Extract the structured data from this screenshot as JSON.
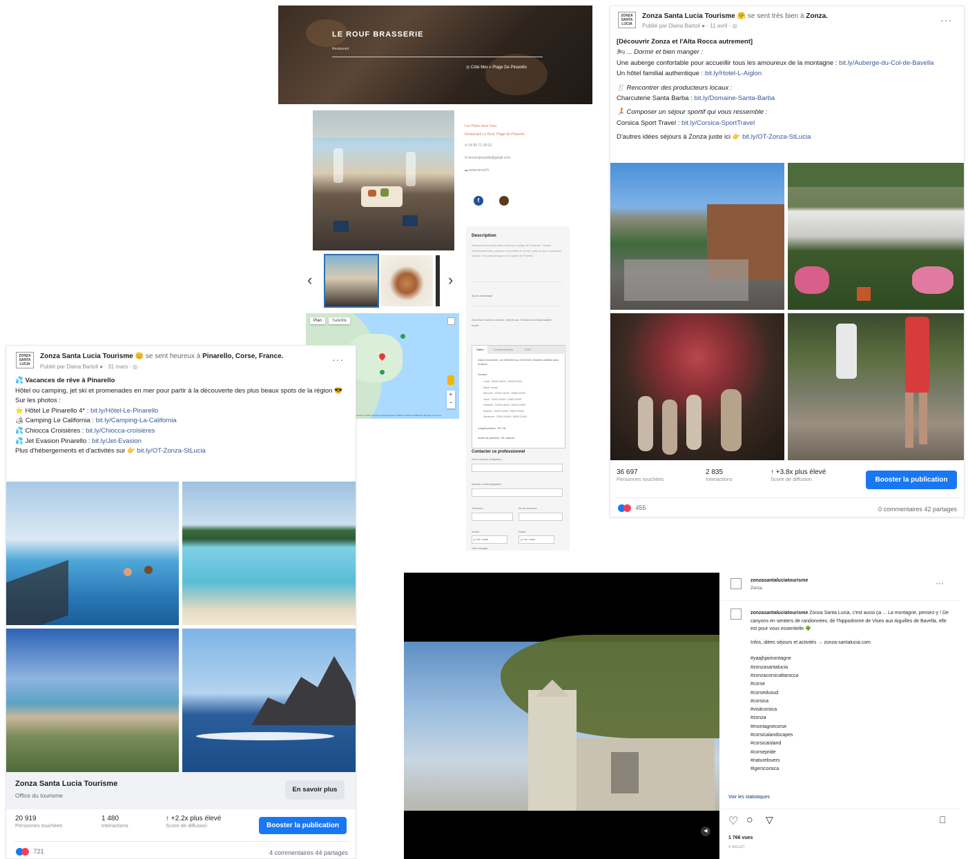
{
  "restaurant": {
    "title": "LE ROUF BRASSERIE",
    "category": "Restaurant",
    "location": "Côté Mer » Plage De Pinarello",
    "contact_lines": [
      "Les Pieds dans l'eau",
      "Restaurant Le Rouf, Plage de Pinarello",
      "04 95 71 09 03",
      "lerouf.pinarello@gmail.com",
      "www.lerouf.fr"
    ],
    "description_title": "Description",
    "description_text": "Restaurant les pieds dans l'eau sur la plage de Pinarello. Cuisine méditerranéenne, poissons et produits de la mer, plats du jour et desserts maison. Vue panoramique sur le golfe de Pinarello.",
    "bullet1": "Accès handicapé",
    "bullet2": "Ouverture d'avril à octobre, midi et soir. Fermeture hebdomadaire: mardi.",
    "tabs": [
      "Dates",
      "Caractéristiques",
      "Tarifs"
    ],
    "dates_title": "Saison d'ouverture : du 15/04/2024 au 31/10/2024. Horaires variables selon la saison.",
    "hours_title": "Horaires",
    "hours": [
      "Lundi : 12h00-14h30 / 19h00-22h00",
      "Mardi : fermé",
      "Mercredi : 12h00-14h30 / 19h00-22h00",
      "Jeudi : 12h00-14h30 / 19h00-22h00",
      "Vendredi : 12h00-14h30 / 19h00-22h00",
      "Samedi : 12h00-14h30 / 19h00-22h00",
      "Dimanche : 12h00-14h30 / 19h00-22h00"
    ],
    "extra1": "Langues parlées : FR, EN",
    "extra2": "Modes de paiement : CB, espèces",
    "contact_title": "Contacter ce professionnel",
    "form": {
      "f1": "Nom et prénom (obligatoire)",
      "f2": "Adresse e-mail (obligatoire)",
      "f3": "Téléphone",
      "f4": "Nb de personnes",
      "f5": "Arrivée",
      "f6": "Départ",
      "f7": "Votre message",
      "date_placeholder": "jj / mm / aaaa"
    },
    "map_tabs": [
      "Plan",
      "Satellite"
    ],
    "map_footer": "Raccourcis clavier   Données cartographiques ©2024   Conditions d'utilisation   Signaler une erreur"
  },
  "fb_post_1": {
    "page": "Zonza Santa Lucia Tourisme",
    "feeling": "😊 se sent heureux à",
    "place": "Pinarello, Corse, France.",
    "sub": "Publié par Diana Bartoli ● · 31 mars · ◎",
    "logo": "ZONZA SANTA LUCIA",
    "lines": [
      {
        "t": "💦 Vacances de rêve à Pinarello",
        "b": true
      },
      {
        "t": "Hôtel ou camping, jet ski et promenades en mer pour partir à la découverte des plus beaux spots de la région 😎"
      },
      {
        "t": "Sur les photos :"
      },
      {
        "t": "⭐ Hôtel Le Pinarello 4* : ",
        "l": "bit.ly/Hôtel-Le-Pinarello"
      },
      {
        "t": "🏕 Camping Le California : ",
        "l": "bit.ly/Camping-La-California"
      },
      {
        "t": "💦 Chiocca Croisières : ",
        "l": "bit.ly/Chiocca-croisières"
      },
      {
        "t": "💦 Jet Evasion Pinarello : ",
        "l": "bit.ly/Jet-Evasion"
      },
      {
        "t": "Plus d'hébergements et d'activités sur 👉 ",
        "l": "bit.ly/OT-Zonza-StLucia"
      }
    ],
    "cta_title": "Zonza Santa Lucia Tourisme",
    "cta_sub": "Office du tourisme",
    "cta_button": "En savoir plus",
    "stats": [
      {
        "num": "20 919",
        "lbl": "Personnes touchées"
      },
      {
        "num": "1 480",
        "lbl": "Interactions"
      },
      {
        "num": "↑ +2.2x plus élevé",
        "lbl": "Score de diffusion"
      }
    ],
    "boost": "Booster la publication",
    "reactions": "721",
    "comments": "4 commentaires  44 partages"
  },
  "fb_post_2": {
    "page": "Zonza Santa Lucia Tourisme",
    "feeling": "🤗 se sent très bien à",
    "place": "Zonza.",
    "sub": "Publié par Diana Bartoli ● · 11 avril · ◎",
    "logo": "ZONZA SANTA LUCIA",
    "lines": [
      {
        "t": "[Découvrir Zonza et l'Alta Rocca autrement]",
        "b": true
      },
      {
        "t": "🛏 ... Dormir et bien manger :",
        "i": true
      },
      {
        "t": "Une auberge confortable pour accueillir tous les amoureux de la montagne : ",
        "l": "bit.ly/Auberge-du-Col-de-Bavella"
      },
      {
        "t": "Un hôtel familial authentique : ",
        "l": "bit.ly/Hotel-L-Aiglon"
      },
      {
        "t": "🍴 Rencontrer des producteurs locaux :",
        "i": true
      },
      {
        "t": "Charcuterie Santa Barba : ",
        "l": "bit.ly/Domaine-Santa-Barba"
      },
      {
        "t": "🏃 Composer un séjour sportif qui vous ressemble :",
        "i": true
      },
      {
        "t": "Corsica Sport Travel : ",
        "l": "bit.ly/Corsica-SportTravel"
      },
      {
        "t": "D'autres idées séjours à Zonza juste ici 👉 ",
        "l": "bit.ly/OT-Zonza-StLucia"
      }
    ],
    "stats": [
      {
        "num": "36 697",
        "lbl": "Personnes touchées"
      },
      {
        "num": "2 835",
        "lbl": "Interactions"
      },
      {
        "num": "↑ +3.8x plus élevé",
        "lbl": "Score de diffusion"
      }
    ],
    "boost": "Booster la publication",
    "reactions": "455",
    "comments": "0 commentaires  42 partages"
  },
  "instagram": {
    "account": "zonzasantaluciatourisme",
    "location": "Zonza",
    "caption_user": "zonzasantaluciatourisme",
    "caption": "Zonza Santa Lucia, c'est aussi ça ... La montagne, pensez-y ! De canyons en sentiers de randonnées, de l'hippodrome de Viseo aux Aiguilles de Bavella, elle est pour vous essentielle 🌳",
    "info": "Infos, idées séjours et activités → zonza-santalucia.com",
    "hashtags": [
      "#yaajhjaimontagne",
      "#zonzasantalucia",
      "#zonzacorsicaltarocca",
      "#corse",
      "#corsedusud",
      "#corsica",
      "#visitcorsica",
      "#zonza",
      "#montagnecorse",
      "#corsicalandscapes",
      "#corsicaisland",
      "#corsepride",
      "#naturelovers",
      "#igerscorsica"
    ],
    "insights": "Voir les statistiques",
    "views": "1 766 vues",
    "date": "4 JUILLET"
  },
  "colors": {
    "fb_blue": "#1877f2",
    "link": "#385898"
  }
}
